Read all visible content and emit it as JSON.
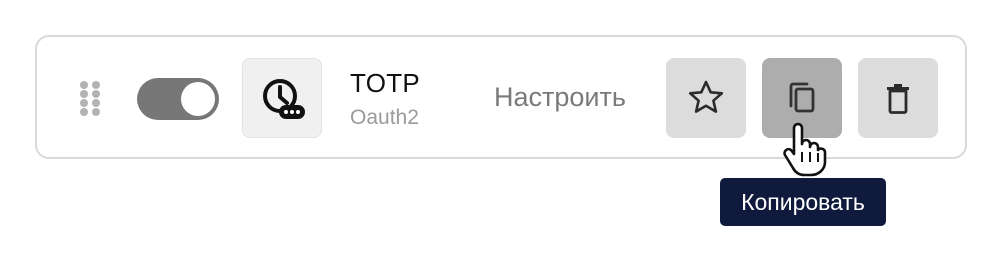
{
  "item": {
    "title": "TOTP",
    "subtitle": "Oauth2",
    "configure_label": "Настроить",
    "enabled": true,
    "icon": "clock-password-icon"
  },
  "actions": {
    "favorite": {
      "icon": "star-icon"
    },
    "copy": {
      "icon": "copy-icon",
      "state": "hover"
    },
    "delete": {
      "icon": "trash-icon"
    }
  },
  "tooltip": {
    "text": "Копировать"
  },
  "colors": {
    "toggle_on": "#777777",
    "tooltip_bg": "#0f1a3d",
    "button_bg": "#dcdcdc",
    "button_active_bg": "#adadad",
    "border": "#d9d9d9"
  }
}
